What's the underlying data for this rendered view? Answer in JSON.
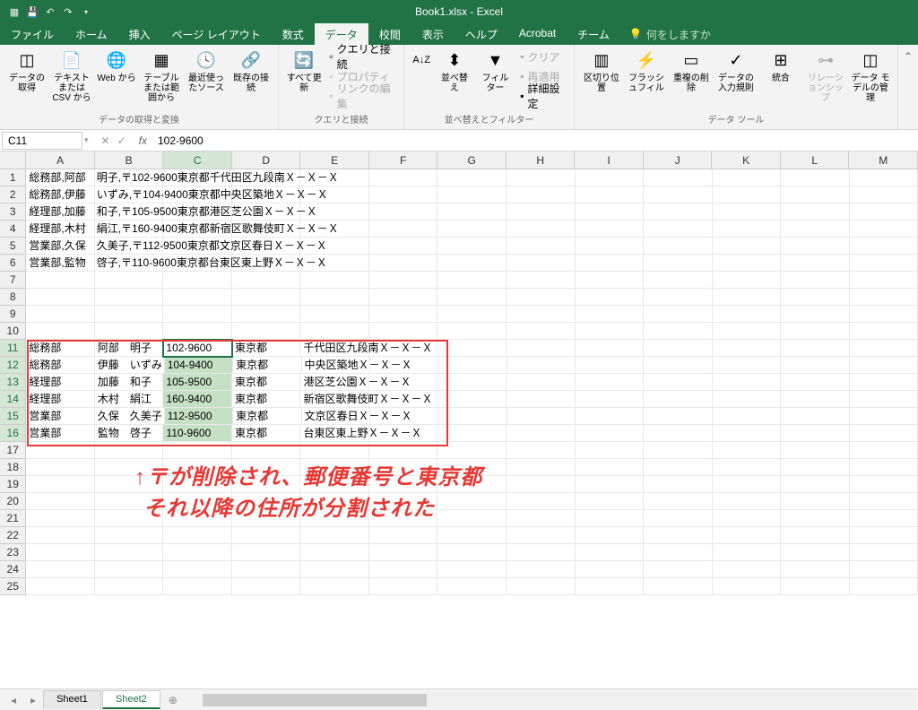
{
  "title": "Book1.xlsx - Excel",
  "qat": {
    "save": "",
    "undo": "",
    "redo": ""
  },
  "tabs": [
    "ファイル",
    "ホーム",
    "挿入",
    "ページ レイアウト",
    "数式",
    "データ",
    "校閲",
    "表示",
    "ヘルプ",
    "Acrobat",
    "チーム"
  ],
  "active_tab": 5,
  "tell_me": "何をしますか",
  "ribbon": {
    "g1": {
      "title": "データの取得と変換",
      "items": [
        "データの取得",
        "テキストまたは CSV から",
        "Web から",
        "テーブルまたは範囲から",
        "最近使ったソース",
        "既存の接続"
      ]
    },
    "g2": {
      "title": "クエリと接続",
      "refresh": "すべて更新",
      "sub": [
        "クエリと接続",
        "プロパティ",
        "リンクの編集"
      ]
    },
    "g3": {
      "title": "並べ替えとフィルター",
      "sort": "並べ替え",
      "filter": "フィルター",
      "sub": [
        "クリア",
        "再適用",
        "詳細設定"
      ]
    },
    "g4": {
      "title": "データ ツール",
      "items": [
        "区切り位置",
        "フラッシュフィル",
        "重複の削除",
        "データの入力規則"
      ],
      "consolidate": "統合",
      "rel": "リレーションシップ",
      "model": "データ モデルの管理"
    }
  },
  "namebox": "C11",
  "formula": "102-9600",
  "cols": [
    "A",
    "B",
    "C",
    "D",
    "E",
    "F",
    "G",
    "H",
    "I",
    "J",
    "K",
    "L",
    "M"
  ],
  "rowmax": 25,
  "topdata": [
    "総務部,阿部　明子,〒102-9600東京都千代田区九段南Ｘ－Ｘ－Ｘ",
    "総務部,伊藤　いずみ,〒104-9400東京都中央区築地Ｘ－Ｘ－Ｘ",
    "経理部,加藤　和子,〒105-9500東京都港区芝公園Ｘ－Ｘ－Ｘ",
    "経理部,木村　絹江,〒160-9400東京都新宿区歌舞伎町Ｘ－Ｘ－Ｘ",
    "営業部,久保　久美子,〒112-9500東京都文京区春日Ｘ－Ｘ－Ｘ",
    "営業部,監物　啓子,〒110-9600東京都台東区東上野Ｘ－Ｘ－Ｘ"
  ],
  "split": [
    {
      "a": "総務部",
      "b": "阿部　明子",
      "c": "102-9600",
      "d": "東京都",
      "e": "千代田区九段南Ｘ－Ｘ－Ｘ"
    },
    {
      "a": "総務部",
      "b": "伊藤　いずみ",
      "c": "104-9400",
      "d": "東京都",
      "e": "中央区築地Ｘ－Ｘ－Ｘ"
    },
    {
      "a": "経理部",
      "b": "加藤　和子",
      "c": "105-9500",
      "d": "東京都",
      "e": "港区芝公園Ｘ－Ｘ－Ｘ"
    },
    {
      "a": "経理部",
      "b": "木村　絹江",
      "c": "160-9400",
      "d": "東京都",
      "e": "新宿区歌舞伎町Ｘ－Ｘ－Ｘ"
    },
    {
      "a": "営業部",
      "b": "久保　久美子",
      "c": "112-9500",
      "d": "東京都",
      "e": "文京区春日Ｘ－Ｘ－Ｘ"
    },
    {
      "a": "営業部",
      "b": "監物　啓子",
      "c": "110-9600",
      "d": "東京都",
      "e": "台東区東上野Ｘ－Ｘ－Ｘ"
    }
  ],
  "sheets": [
    "Sheet1",
    "Sheet2"
  ],
  "active_sheet": 1,
  "annotation1": "↑〒が削除され、郵便番号と東京都",
  "annotation2": "それ以降の住所が分割された"
}
